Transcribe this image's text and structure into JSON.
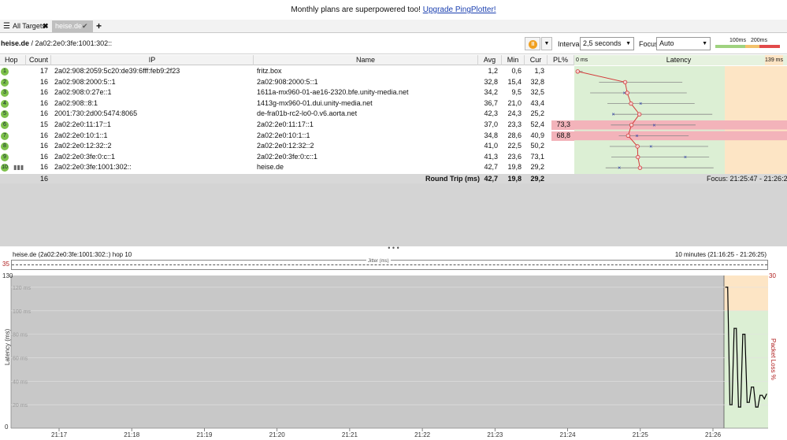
{
  "banner": {
    "text": "Monthly plans are superpowered too!",
    "link": "Upgrade PingPlotter!"
  },
  "tabs": {
    "all_targets": "All Targets",
    "active": "heise.de"
  },
  "toolbar": {
    "target_host": "heise.de",
    "target_ip": " / 2a02:2e0:3fe:1001:302::",
    "interval_label": "Interval",
    "interval_value": "2,5 seconds",
    "focus_label": "Focus",
    "focus_value": "Auto",
    "scale_100": "100ms",
    "scale_200": "200ms"
  },
  "columns": {
    "hop": "Hop",
    "count": "Count",
    "ip": "IP",
    "name": "Name",
    "avg": "Avg",
    "min": "Min",
    "cur": "Cur",
    "pl": "PL%",
    "latency_min": "0 ms",
    "latency": "Latency",
    "latency_max": "139 ms"
  },
  "hops": [
    {
      "hop": "1",
      "count": "17",
      "ip": "2a02:908:2059:5c20:de39:6fff:feb9:2f23",
      "name": "fritz.box",
      "avg": "1,2",
      "min": "0,6",
      "cur": "1,3",
      "pl": "",
      "avg_ms": 1.2,
      "min_ms": 0.6,
      "cur_ms": 1.3
    },
    {
      "hop": "2",
      "count": "16",
      "ip": "2a02:908:2000:5::1",
      "name": "2a02:908:2000:5::1",
      "avg": "32,8",
      "min": "15,4",
      "cur": "32,8",
      "pl": "",
      "avg_ms": 32.8,
      "min_ms": 15.4,
      "cur_ms": 32.8
    },
    {
      "hop": "3",
      "count": "16",
      "ip": "2a02:908:0:27e::1",
      "name": "1611a-mx960-01-ae16-2320.bfe.unity-media.net",
      "avg": "34,2",
      "min": "9,5",
      "cur": "32,5",
      "pl": "",
      "avg_ms": 34.2,
      "min_ms": 9.5,
      "cur_ms": 32.5
    },
    {
      "hop": "4",
      "count": "16",
      "ip": "2a02:908::8:1",
      "name": "1413g-mx960-01.dui.unity-media.net",
      "avg": "36,7",
      "min": "21,0",
      "cur": "43,4",
      "pl": "",
      "avg_ms": 36.7,
      "min_ms": 21.0,
      "cur_ms": 43.4
    },
    {
      "hop": "5",
      "count": "16",
      "ip": "2001:730:2d00:5474:8065",
      "name": "de-fra01b-rc2-lo0-0.v6.aorta.net",
      "avg": "42,3",
      "min": "24,3",
      "cur": "25,2",
      "pl": "",
      "avg_ms": 42.3,
      "min_ms": 24.3,
      "cur_ms": 25.2
    },
    {
      "hop": "6",
      "count": "15",
      "ip": "2a02:2e0:11:17::1",
      "name": "2a02:2e0:11:17::1",
      "avg": "37,0",
      "min": "23,3",
      "cur": "52,4",
      "pl": "73,3",
      "avg_ms": 37.0,
      "min_ms": 23.3,
      "cur_ms": 52.4,
      "pl_pct": 73.3
    },
    {
      "hop": "7",
      "count": "16",
      "ip": "2a02:2e0:10:1::1",
      "name": "2a02:2e0:10:1::1",
      "avg": "34,8",
      "min": "28,6",
      "cur": "40,9",
      "pl": "68,8",
      "avg_ms": 34.8,
      "min_ms": 28.6,
      "cur_ms": 40.9,
      "pl_pct": 68.8
    },
    {
      "hop": "8",
      "count": "16",
      "ip": "2a02:2e0:12:32::2",
      "name": "2a02:2e0:12:32::2",
      "avg": "41,0",
      "min": "22,5",
      "cur": "50,2",
      "pl": "",
      "avg_ms": 41.0,
      "min_ms": 22.5,
      "cur_ms": 50.2
    },
    {
      "hop": "9",
      "count": "16",
      "ip": "2a02:2e0:3fe:0:c::1",
      "name": "2a02:2e0:3fe:0:c::1",
      "avg": "41,3",
      "min": "23,6",
      "cur": "73,1",
      "pl": "",
      "avg_ms": 41.3,
      "min_ms": 23.6,
      "cur_ms": 73.1
    },
    {
      "hop": "10",
      "count": "16",
      "ip": "2a02:2e0:3fe:1001:302::",
      "name": "heise.de",
      "avg": "42,7",
      "min": "19,8",
      "cur": "29,2",
      "pl": "",
      "avg_ms": 42.7,
      "min_ms": 19.8,
      "cur_ms": 29.2
    }
  ],
  "summary": {
    "count": "16",
    "label": "Round Trip (ms)",
    "avg": "42,7",
    "min": "19,8",
    "cur": "29,2",
    "focus": "Focus: 21:25:47 - 21:26:25"
  },
  "lower": {
    "title": "heise.de (2a02:2e0:3fe:1001:302::) hop 10",
    "range": "10 minutes (21:16:25 - 21:26:25)",
    "jitter_label": "Jitter (ms)",
    "jitter_max": "35",
    "y_max": "130",
    "y_min": "0",
    "ylabel": "Latency (ms)",
    "y2label": "Packet Loss %",
    "y2_max": "30",
    "gridlines": [
      "120 ms",
      "100 ms",
      "80 ms",
      "60 ms",
      "40 ms",
      "20 ms"
    ],
    "times": [
      "21:17",
      "21:18",
      "21:19",
      "21:20",
      "21:21",
      "21:22",
      "21:23",
      "21:24",
      "21:25",
      "21:26"
    ]
  },
  "chart_data": {
    "type": "line",
    "ylabel": "Latency (ms)",
    "ylim": [
      0,
      130
    ],
    "x": [
      "21:25:47",
      "21:25:49",
      "21:25:51",
      "21:25:53",
      "21:25:55",
      "21:25:57",
      "21:25:59",
      "21:26:01",
      "21:26:03",
      "21:26:05",
      "21:26:07",
      "21:26:09",
      "21:26:11",
      "21:26:13",
      "21:26:15",
      "21:26:17",
      "21:26:19",
      "21:26:21",
      "21:26:23",
      "21:26:25"
    ],
    "series": [
      {
        "values": [
          120,
          120,
          20,
          20,
          85,
          85,
          18,
          18,
          80,
          80,
          22,
          22,
          35,
          35,
          18,
          18,
          28,
          28,
          25,
          29
        ]
      }
    ],
    "colors": {
      "line": "#000000",
      "green_zone": "#dcefd4",
      "orange_zone": "#fde5c5",
      "red_line": "#d33a3a"
    }
  }
}
